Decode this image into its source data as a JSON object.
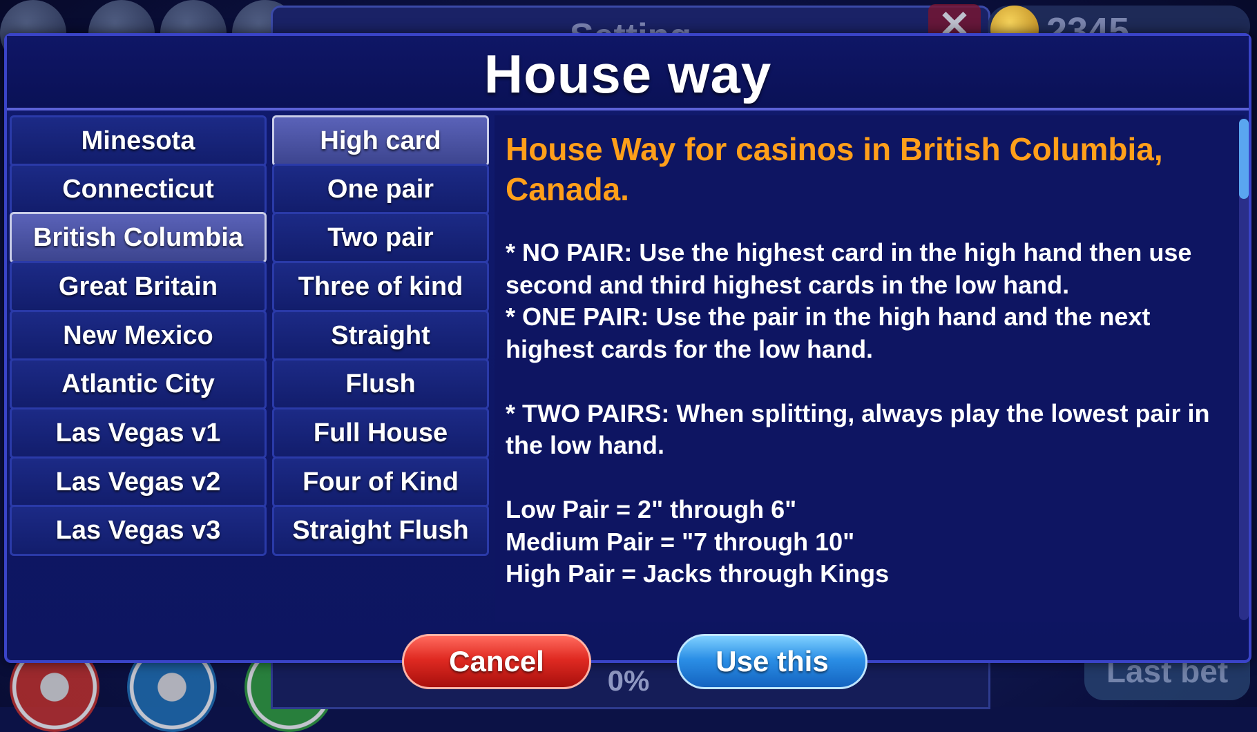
{
  "background": {
    "settings_title": "Setting",
    "close_symbol": "✕",
    "coin_balance": "2345",
    "progress_percent": "0%",
    "last_bet_label": "Last bet"
  },
  "dialog": {
    "title": "House way",
    "regions": [
      "Minesota",
      "Connecticut",
      "British Columbia",
      "Great Britain",
      "New Mexico",
      "Atlantic City",
      "Las Vegas v1",
      "Las Vegas v2",
      "Las Vegas v3"
    ],
    "selected_region": "British Columbia",
    "hands": [
      "High card",
      "One pair",
      "Two pair",
      "Three of kind",
      "Straight",
      "Flush",
      "Full House",
      "Four of Kind",
      "Straight Flush"
    ],
    "selected_hand": "High card",
    "description_title": "House Way for casinos in British Columbia, Canada.",
    "description_body": "* NO PAIR: Use the highest card in the high hand then use second and third highest cards in the low hand.\n* ONE PAIR: Use the pair in the high hand and the next highest cards for the low hand.\n\n* TWO PAIRS: When splitting, always play the lowest pair in the low hand.\n\nLow Pair = 2\" through 6\"\nMedium Pair = \"7 through 10\"\nHigh Pair = Jacks through Kings",
    "cancel_label": "Cancel",
    "use_label": "Use this"
  },
  "colors": {
    "accent_orange": "#ff9f1a",
    "cancel_red": "#e02a22",
    "use_blue": "#2b8fe6",
    "dialog_border": "#3a44c8"
  }
}
